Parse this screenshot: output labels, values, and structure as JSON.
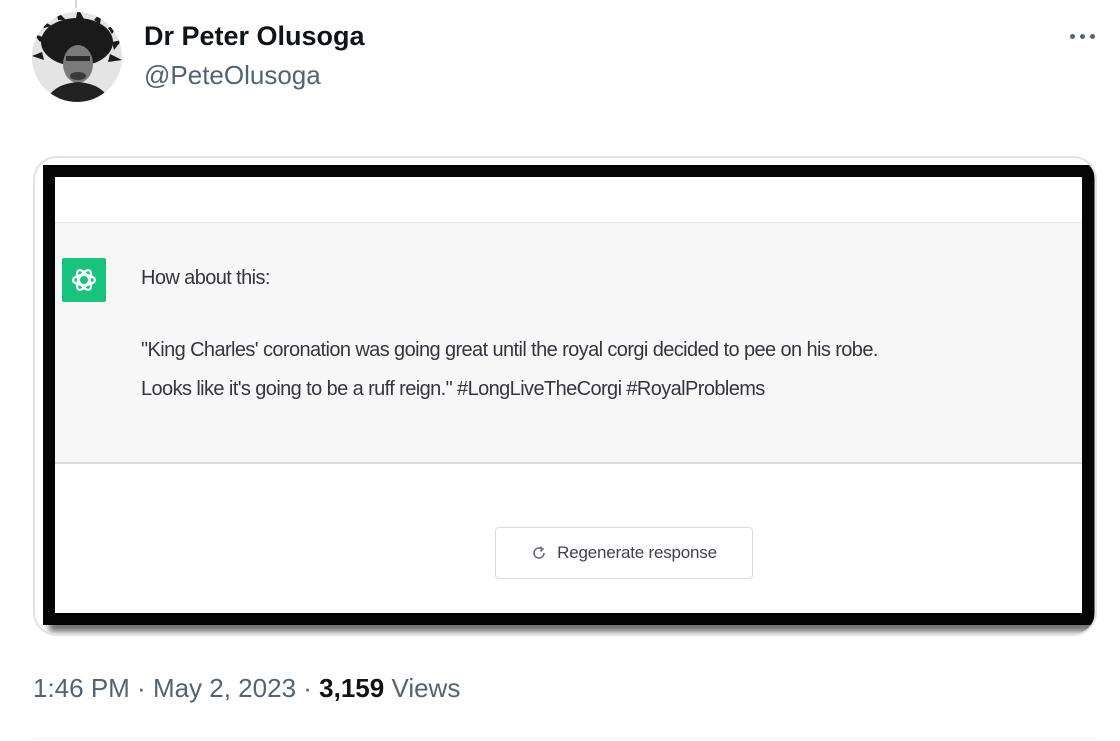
{
  "author": {
    "display_name": "Dr Peter Olusoga",
    "handle": "@PeteOlusoga"
  },
  "media": {
    "chatgpt_intro": "How about this:",
    "chatgpt_line1": "\"King Charles' coronation was going great until the royal corgi decided to pee on his robe.",
    "chatgpt_line2": "Looks like it's going to be a ruff reign.\" #LongLiveTheCorgi #RoyalProblems",
    "regenerate_label": "Regenerate response",
    "accent_color": "#19c37d"
  },
  "meta": {
    "time": "1:46 PM",
    "separator": " · ",
    "date": "May 2, 2023",
    "views_count": "3,159",
    "views_label": "Views"
  },
  "icons": {
    "more": "more-dots-icon",
    "gpt": "openai-logo-icon",
    "regenerate": "refresh-icon"
  }
}
